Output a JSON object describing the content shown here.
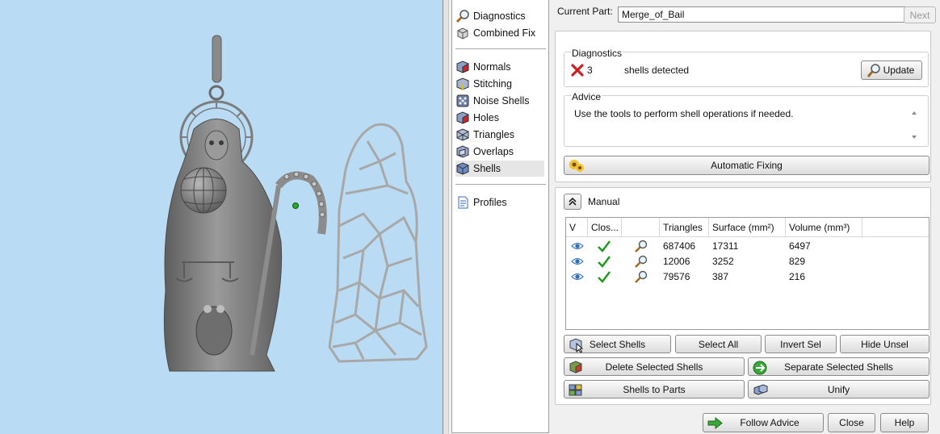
{
  "nav": {
    "items": [
      {
        "label": "Diagnostics",
        "icon": "magnifier-icon"
      },
      {
        "label": "Combined Fix",
        "icon": "cube-fix-icon"
      },
      {
        "label": "Normals",
        "icon": "normals-cube-icon"
      },
      {
        "label": "Stitching",
        "icon": "stitching-cube-icon"
      },
      {
        "label": "Noise Shells",
        "icon": "noise-shells-icon"
      },
      {
        "label": "Holes",
        "icon": "holes-cube-icon"
      },
      {
        "label": "Triangles",
        "icon": "triangles-cube-icon"
      },
      {
        "label": "Overlaps",
        "icon": "overlaps-cube-icon"
      },
      {
        "label": "Shells",
        "icon": "shells-cube-icon"
      },
      {
        "label": "Profiles",
        "icon": "document-icon"
      }
    ],
    "selected": "Shells"
  },
  "part": {
    "label": "Current Part:",
    "value": "Merge_of_Bail",
    "next_label": "Next"
  },
  "diagnostics": {
    "title": "Diagnostics",
    "count": "3",
    "text": "shells detected",
    "update_label": "Update"
  },
  "advice": {
    "title": "Advice",
    "text": "Use the tools to perform shell operations if needed."
  },
  "auto_fix_label": "Automatic Fixing",
  "manual": {
    "title": "Manual",
    "headers": [
      "V",
      "Clos...",
      "",
      "Triangles",
      "Surface (mm²)",
      "Volume (mm³)"
    ],
    "rows": [
      {
        "triangles": "687406",
        "surface": "17311",
        "volume": "6497"
      },
      {
        "triangles": "12006",
        "surface": "3252",
        "volume": "829"
      },
      {
        "triangles": "79576",
        "surface": "387",
        "volume": "216"
      }
    ]
  },
  "buttons": {
    "select_shells": "Select Shells",
    "select_all": "Select All",
    "invert_sel": "Invert Sel",
    "hide_unsel": "Hide Unsel",
    "delete_selected": "Delete Selected Shells",
    "separate_selected": "Separate Selected Shells",
    "shells_to_parts": "Shells to Parts",
    "unify": "Unify"
  },
  "footer": {
    "follow_advice": "Follow Advice",
    "close": "Close",
    "help": "Help"
  },
  "colors": {
    "viewport_bg": "#b9dcf4",
    "model_gray": "#7d7d7d",
    "error_red": "#cc2020",
    "ok_green": "#1c9a1c",
    "eye_blue": "#2f6fb5"
  }
}
